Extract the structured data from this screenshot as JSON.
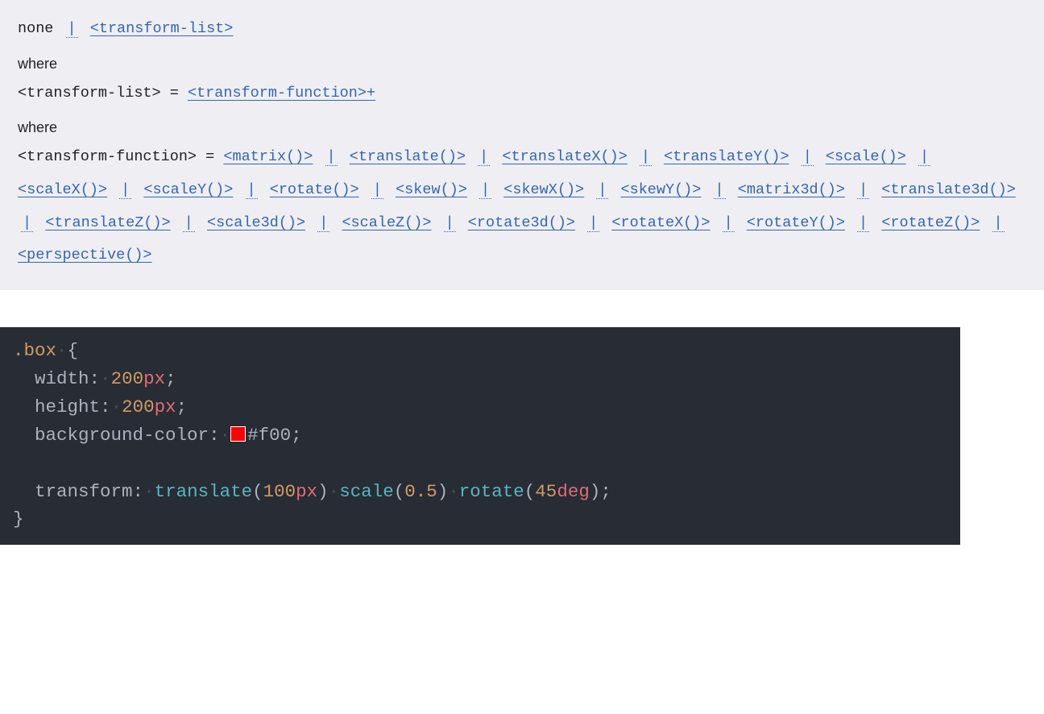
{
  "syntax": {
    "line1": {
      "none": "none",
      "sep": "|",
      "transform_list": "<transform-list>"
    },
    "where1": "where",
    "line2": {
      "lhs": "<transform-list> =",
      "link": "<transform-function>",
      "plus": "+"
    },
    "where2": "where",
    "funcs_lhs": "<transform-function> =",
    "funcs": [
      "<matrix()>",
      "<translate()>",
      "<translateX()>",
      "<translateY()>",
      "<scale()>",
      "<scaleX()>",
      "<scaleY()>",
      "<rotate()>",
      "<skew()>",
      "<skewX()>",
      "<skewY()>",
      "<matrix3d()>",
      "<translate3d()>",
      "<translateZ()>",
      "<scale3d()>",
      "<scaleZ()>",
      "<rotate3d()>",
      "<rotateX()>",
      "<rotateY()>",
      "<rotateZ()>",
      "<perspective()>"
    ],
    "sep_token": "|"
  },
  "code": {
    "selector": ".box",
    "ws_dot": "·",
    "open": "{",
    "close": "}",
    "semicolon": ";",
    "colon": ":",
    "paren_open": "(",
    "paren_close": ")",
    "decls": {
      "width": {
        "prop": "width",
        "num": "200",
        "unit": "px"
      },
      "height": {
        "prop": "height",
        "num": "200",
        "unit": "px"
      },
      "bg": {
        "prop": "background-color",
        "swatch": "#ff0000",
        "hex": "#f00"
      },
      "transform": {
        "prop": "transform",
        "fn1": "translate",
        "arg1_num": "100",
        "arg1_unit": "px",
        "fn2": "scale",
        "arg2_num": "0.5",
        "fn3": "rotate",
        "arg3_num": "45",
        "arg3_unit": "deg"
      }
    }
  }
}
